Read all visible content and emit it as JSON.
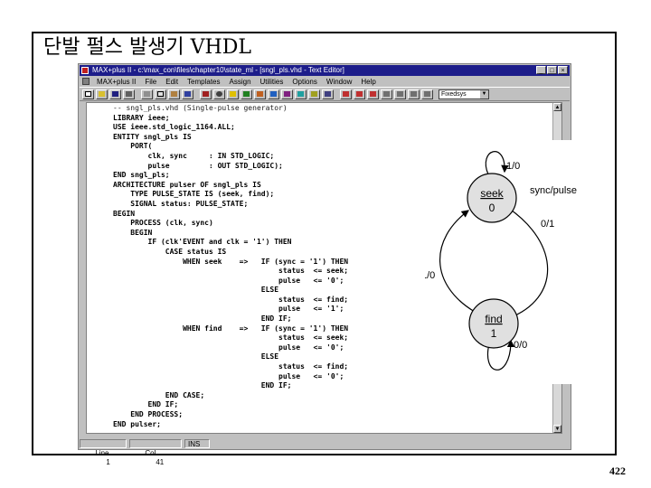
{
  "slide": {
    "title": "단발 펄스 발생기 VHDL",
    "page_number": "422"
  },
  "window": {
    "title": "MAX+plus II - c:\\max_con\\files\\chapter10\\state_ml - [sngl_pls.vhd - Text Editor]",
    "buttons": {
      "minimize": "_",
      "maximize": "□",
      "close": "×"
    }
  },
  "menu": {
    "items": [
      "MAX+plus II",
      "File",
      "Edit",
      "Templates",
      "Assign",
      "Utilities",
      "Options",
      "Window",
      "Help"
    ]
  },
  "toolbar": {
    "font_select": "Fixedsys"
  },
  "editor": {
    "code_lines": [
      "-- sngl_pls.vhd (Single-pulse generator)",
      "LIBRARY ieee;",
      "USE ieee.std_logic_1164.ALL;",
      "ENTITY sngl_pls IS",
      "    PORT(",
      "        clk, sync     : IN STD_LOGIC;",
      "        pulse         : OUT STD_LOGIC);",
      "END sngl_pls;",
      "ARCHITECTURE pulser OF sngl_pls IS",
      "    TYPE PULSE_STATE IS (seek, find);",
      "    SIGNAL status: PULSE_STATE;",
      "BEGIN",
      "    PROCESS (clk, sync)",
      "    BEGIN",
      "        IF (clk'EVENT and clk = '1') THEN",
      "            CASE status IS",
      "                WHEN seek    =>   IF (sync = '1') THEN",
      "                                      status  <= seek;",
      "                                      pulse   <= '0';",
      "                                  ELSE",
      "                                      status  <= find;",
      "                                      pulse   <= '1';",
      "                                  END IF;",
      "                WHEN find    =>   IF (sync = '1') THEN",
      "                                      status  <= seek;",
      "                                      pulse   <= '0';",
      "                                  ELSE",
      "                                      status  <= find;",
      "                                      pulse   <= '0';",
      "                                  END IF;",
      "            END CASE;",
      "        END IF;",
      "    END PROCESS;",
      "END pulser;"
    ]
  },
  "status": {
    "line_label": "Line",
    "line_value": "1",
    "col_label": "Col",
    "col_value": "41",
    "mode": "INS"
  },
  "state_diagram": {
    "header_label": "sync/pulse",
    "states": [
      {
        "name": "seek",
        "output": "0"
      },
      {
        "name": "find",
        "output": "1"
      }
    ],
    "transitions": [
      {
        "label": "1/0",
        "from": "seek",
        "to": "seek"
      },
      {
        "label": "0/1",
        "from": "seek",
        "to": "find"
      },
      {
        "label": "1/0",
        "from": "find",
        "to": "seek"
      },
      {
        "label": "0/0",
        "from": "find",
        "to": "find"
      }
    ]
  }
}
